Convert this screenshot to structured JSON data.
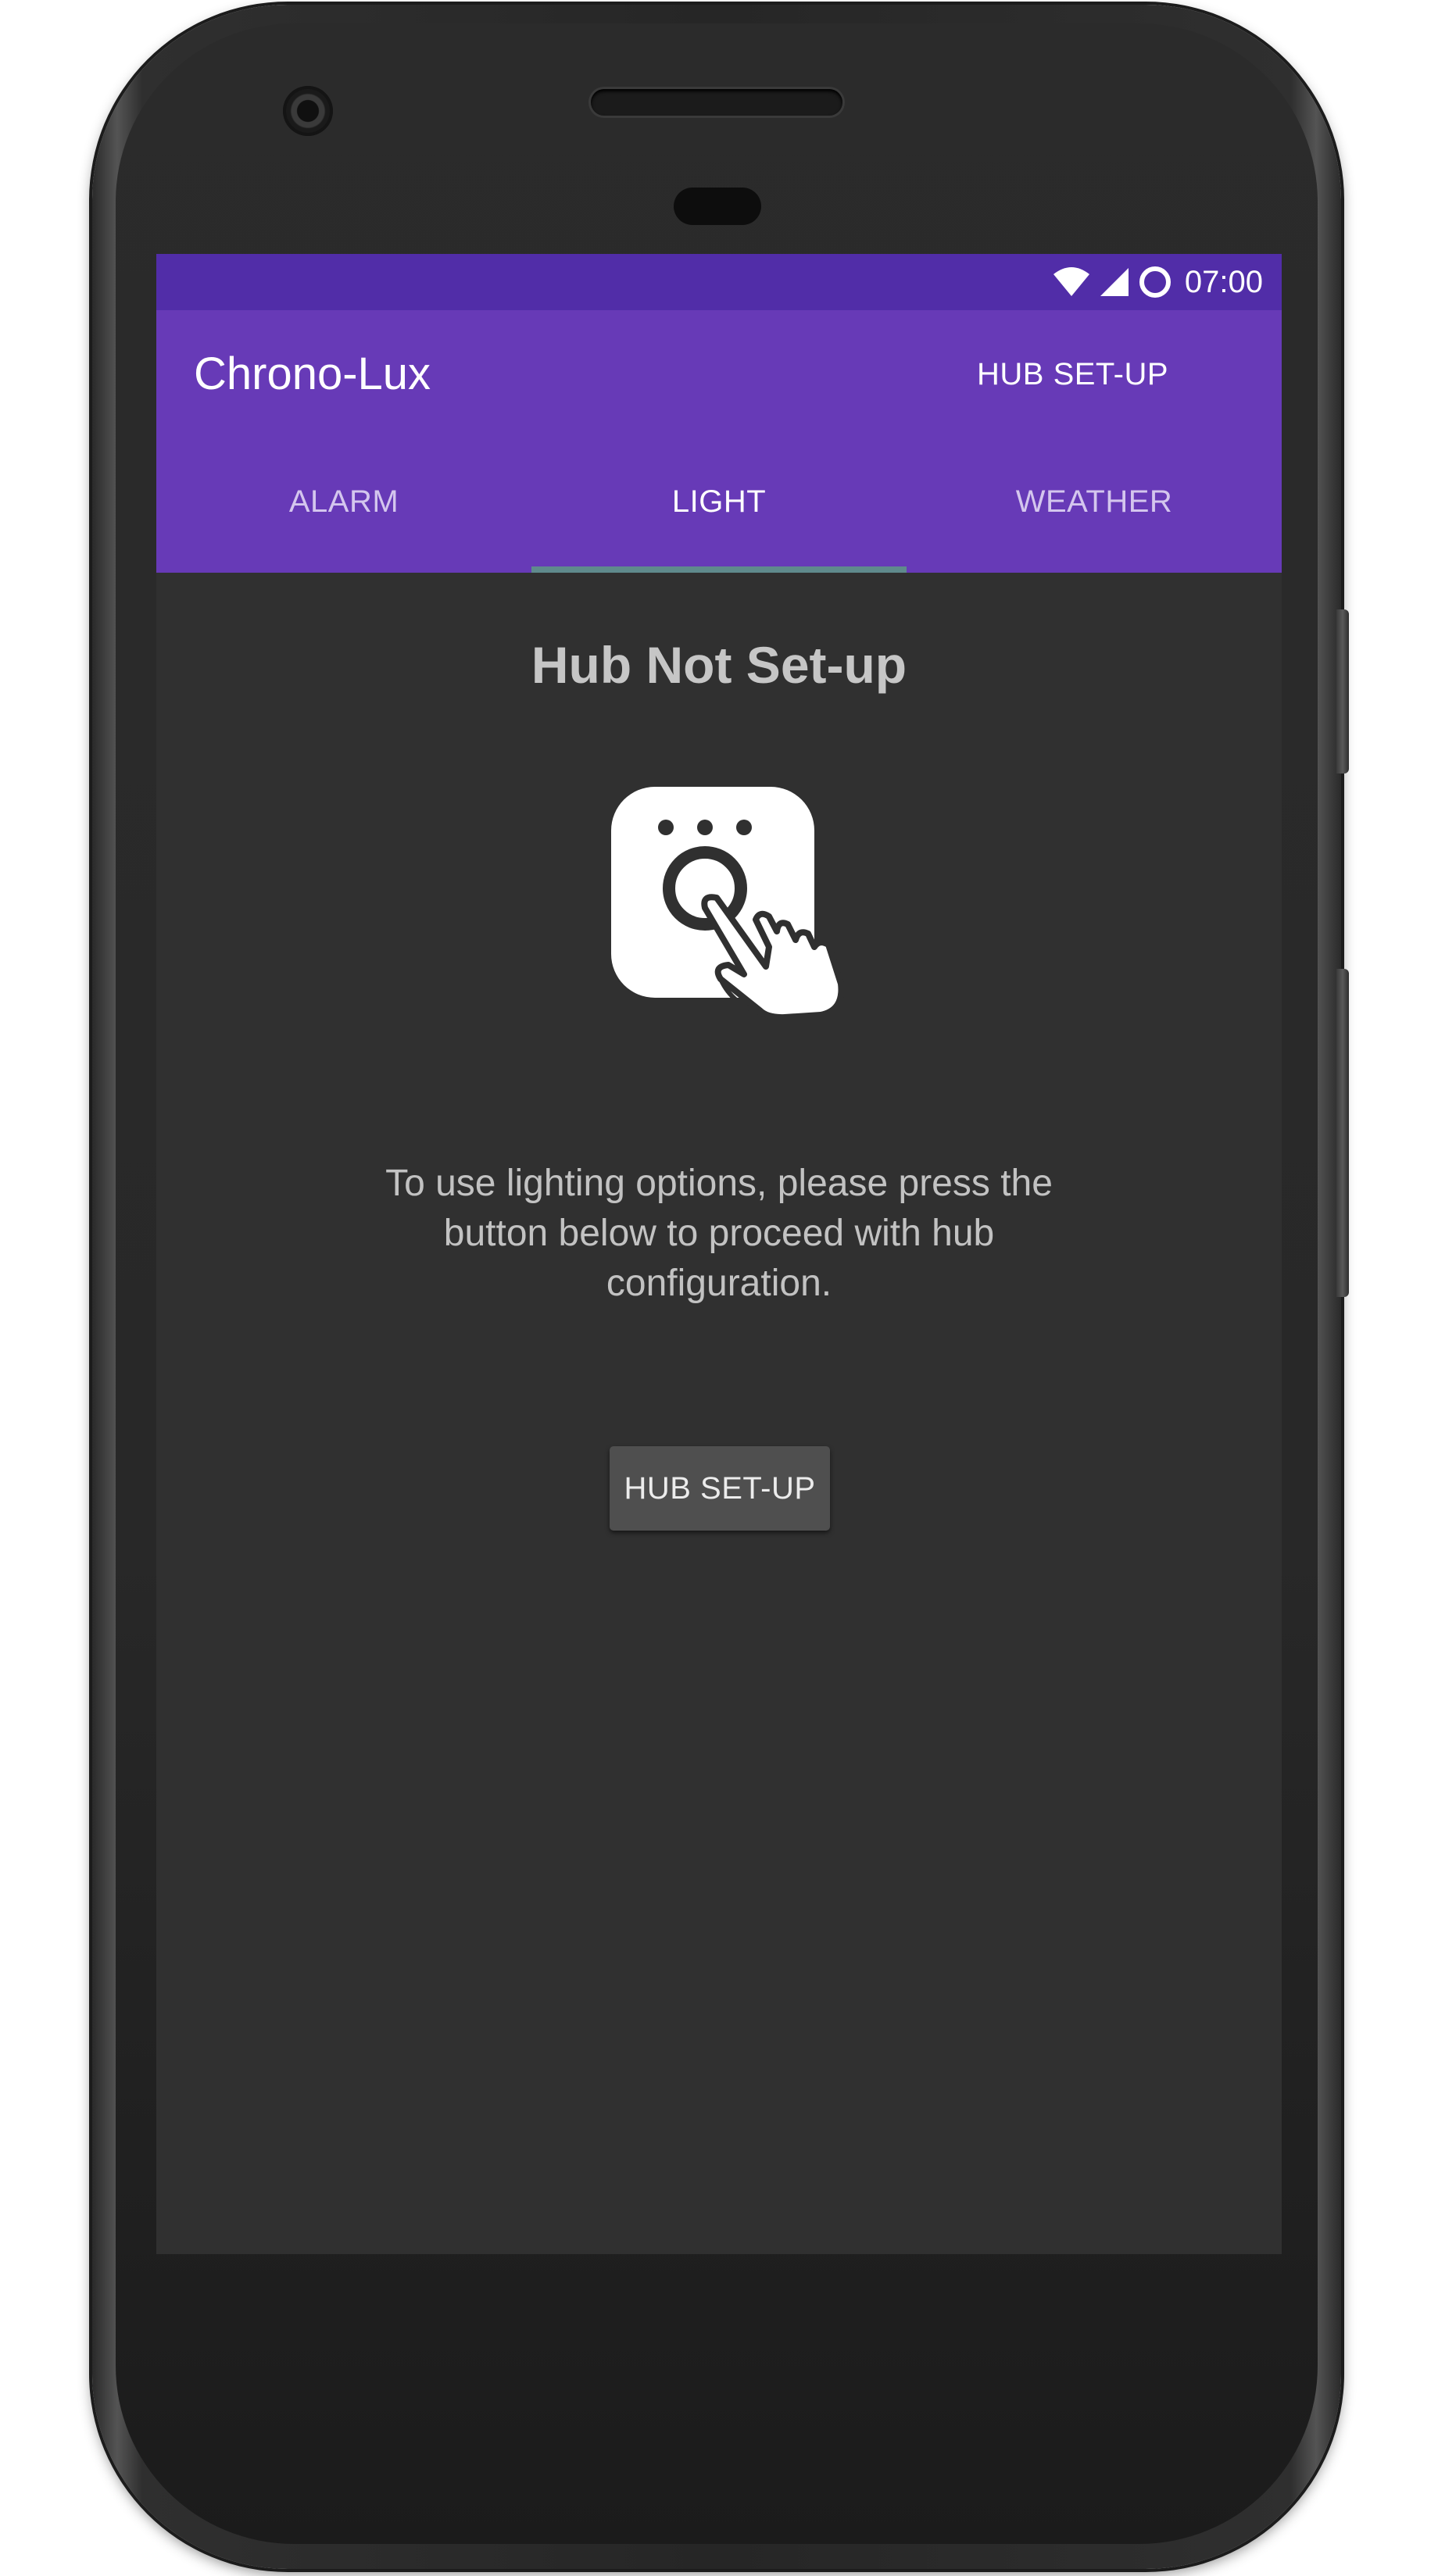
{
  "status_bar": {
    "time": "07:00",
    "icons": [
      "wifi-icon",
      "cell-signal-icon",
      "circle-indicator-icon"
    ]
  },
  "app_bar": {
    "title": "Chrono-Lux",
    "action_label": "HUB SET-UP",
    "overflow_icon": "more-vertical-icon"
  },
  "tabs": [
    {
      "label": "ALARM",
      "active": false
    },
    {
      "label": "LIGHT",
      "active": true
    },
    {
      "label": "WEATHER",
      "active": false
    }
  ],
  "content": {
    "title": "Hub Not Set-up",
    "icon": "hub-press-button-icon",
    "message": "To use lighting options, please press the button below to proceed with hub configuration.",
    "button_label": "HUB SET-UP"
  },
  "colors": {
    "status_bar": "#512da8",
    "app_bar": "#673ab7",
    "background": "#303030",
    "tab_indicator": "#5f8a8c",
    "button": "#4f4f4f"
  }
}
